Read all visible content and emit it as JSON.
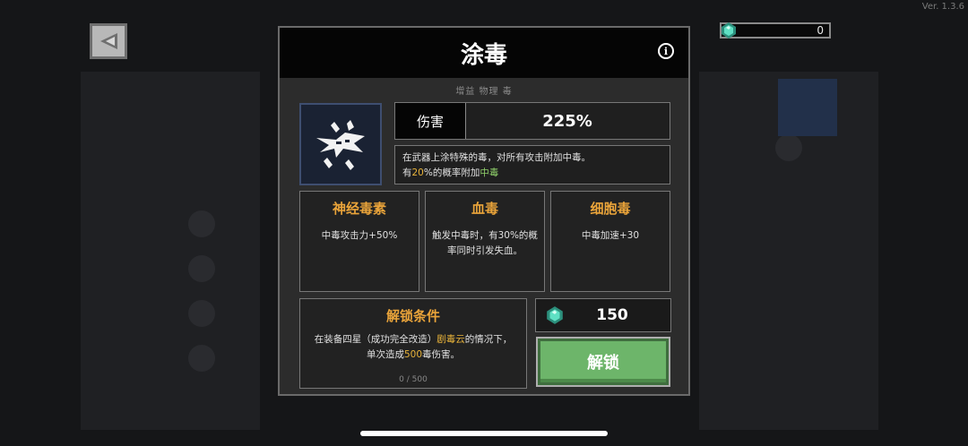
{
  "app": {
    "version": "Ver. 1.3.6"
  },
  "currency": {
    "amount": "0",
    "icon": "gem-icon",
    "color": "#3fb8a0"
  },
  "modal": {
    "title": "涂毒",
    "tags": "增益 物理 毒",
    "skill_icon": "poison-blade-icon",
    "damage": {
      "label": "伤害",
      "value": "225%"
    },
    "description": {
      "line1": "在武器上涂特殊的毒，对所有攻击附加中毒。",
      "line2_pre": "有",
      "line2_pct": "20",
      "line2_mid": "%的概率附加",
      "line2_effect": "中毒"
    },
    "upgrades": [
      {
        "title": "神经毒素",
        "desc": "中毒攻击力+50%"
      },
      {
        "title": "血毒",
        "desc": "触发中毒时，有30%的概率同时引发失血。"
      },
      {
        "title": "细胞毒",
        "desc": "中毒加速+30"
      }
    ],
    "unlock": {
      "title": "解锁条件",
      "line1_pre": "在装备四星（成功完全改造）",
      "line1_weapon": "剧毒云",
      "line1_post": "的情况下，",
      "line2_pre": "单次造成",
      "line2_num": "500",
      "line2_post": "毒伤害。",
      "progress": "0 / 500"
    },
    "cost": {
      "amount": "150"
    },
    "unlock_button": "解锁"
  },
  "colors": {
    "accent_orange": "#eaa43a",
    "accent_green": "#8fcf6a",
    "button_green": "#6db56a"
  }
}
